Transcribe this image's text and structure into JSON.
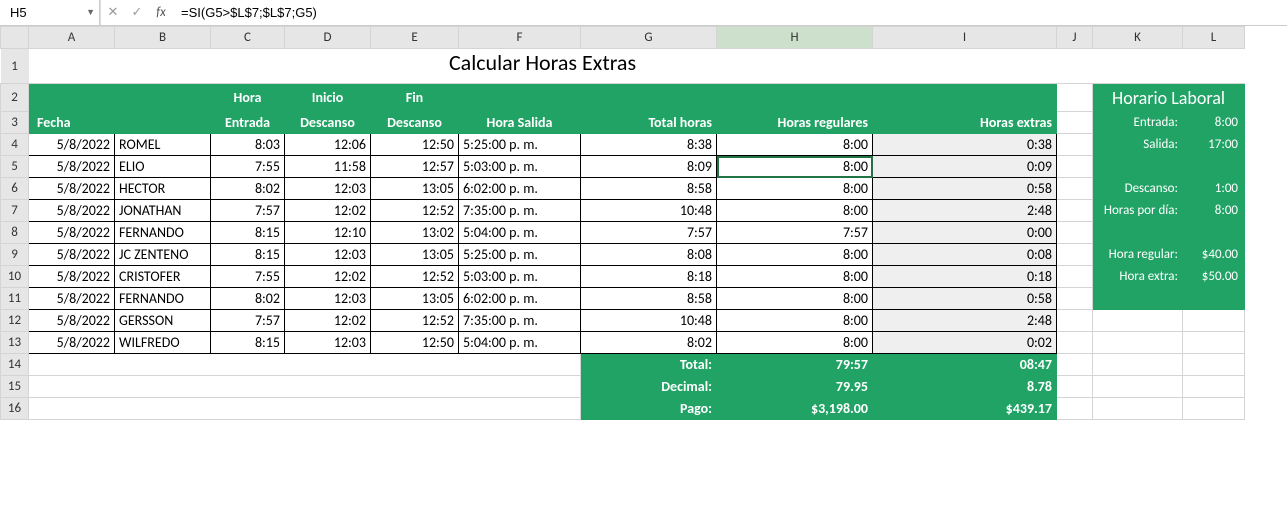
{
  "nameBox": "H5",
  "formula": "=SI(G5>$L$7;$L$7;G5)",
  "columns": [
    "A",
    "B",
    "C",
    "D",
    "E",
    "F",
    "G",
    "H",
    "I",
    "J",
    "K",
    "L"
  ],
  "title": "Calcular Horas Extras",
  "headers": {
    "fecha": "Fecha",
    "horaEntradaTop": "Hora",
    "horaEntradaBot": "Entrada",
    "iniDescTop": "Inicio",
    "iniDescBot": "Descanso",
    "finDescTop": "Fin",
    "finDescBot": "Descanso",
    "horaSalida": "Hora Salida",
    "totalHoras": "Total horas",
    "horasReg": "Horas regulares",
    "horasExt": "Horas extras"
  },
  "rows": [
    {
      "fecha": "5/8/2022",
      "nombre": "ROMEL",
      "entrada": "8:03",
      "iniDesc": "12:06",
      "finDesc": "12:50",
      "salida": "5:25:00 p. m.",
      "total": "8:38",
      "reg": "8:00",
      "ext": "0:38"
    },
    {
      "fecha": "5/8/2022",
      "nombre": "ELIO",
      "entrada": "7:55",
      "iniDesc": "11:58",
      "finDesc": "12:57",
      "salida": "5:03:00 p. m.",
      "total": "8:09",
      "reg": "8:00",
      "ext": "0:09"
    },
    {
      "fecha": "5/8/2022",
      "nombre": "HECTOR",
      "entrada": "8:02",
      "iniDesc": "12:03",
      "finDesc": "13:05",
      "salida": "6:02:00 p. m.",
      "total": "8:58",
      "reg": "8:00",
      "ext": "0:58"
    },
    {
      "fecha": "5/8/2022",
      "nombre": "JONATHAN",
      "entrada": "7:57",
      "iniDesc": "12:02",
      "finDesc": "12:52",
      "salida": "7:35:00 p. m.",
      "total": "10:48",
      "reg": "8:00",
      "ext": "2:48"
    },
    {
      "fecha": "5/8/2022",
      "nombre": "FERNANDO",
      "entrada": "8:15",
      "iniDesc": "12:10",
      "finDesc": "13:02",
      "salida": "5:04:00 p. m.",
      "total": "7:57",
      "reg": "7:57",
      "ext": "0:00"
    },
    {
      "fecha": "5/8/2022",
      "nombre": "JC ZENTENO",
      "entrada": "8:15",
      "iniDesc": "12:03",
      "finDesc": "13:05",
      "salida": "5:25:00 p. m.",
      "total": "8:08",
      "reg": "8:00",
      "ext": "0:08"
    },
    {
      "fecha": "5/8/2022",
      "nombre": "CRISTOFER",
      "entrada": "7:55",
      "iniDesc": "12:02",
      "finDesc": "12:52",
      "salida": "5:03:00 p. m.",
      "total": "8:18",
      "reg": "8:00",
      "ext": "0:18"
    },
    {
      "fecha": "5/8/2022",
      "nombre": "FERNANDO",
      "entrada": "8:02",
      "iniDesc": "12:03",
      "finDesc": "13:05",
      "salida": "6:02:00 p. m.",
      "total": "8:58",
      "reg": "8:00",
      "ext": "0:58"
    },
    {
      "fecha": "5/8/2022",
      "nombre": "GERSSON",
      "entrada": "7:57",
      "iniDesc": "12:02",
      "finDesc": "12:52",
      "salida": "7:35:00 p. m.",
      "total": "10:48",
      "reg": "8:00",
      "ext": "2:48"
    },
    {
      "fecha": "5/8/2022",
      "nombre": "WILFREDO",
      "entrada": "8:15",
      "iniDesc": "12:03",
      "finDesc": "12:50",
      "salida": "5:04:00 p. m.",
      "total": "8:02",
      "reg": "8:00",
      "ext": "0:02"
    }
  ],
  "summary": {
    "totalLbl": "Total:",
    "totalReg": "79:57",
    "totalExt": "08:47",
    "decLbl": "Decimal:",
    "decReg": "79.95",
    "decExt": "8.78",
    "pagoLbl": "Pago:",
    "pagoReg": "$3,198.00",
    "pagoExt": "$439.17"
  },
  "side": {
    "title": "Horario Laboral",
    "entradaLbl": "Entrada:",
    "entradaVal": "8:00",
    "salidaLbl": "Salida:",
    "salidaVal": "17:00",
    "descansoLbl": "Descanso:",
    "descansoVal": "1:00",
    "horasDiaLbl": "Horas por día:",
    "horasDiaVal": "8:00",
    "horaRegLbl": "Hora regular:",
    "horaRegVal": "$40.00",
    "horaExtLbl": "Hora extra:",
    "horaExtVal": "$50.00"
  },
  "selectedCell": "H5"
}
